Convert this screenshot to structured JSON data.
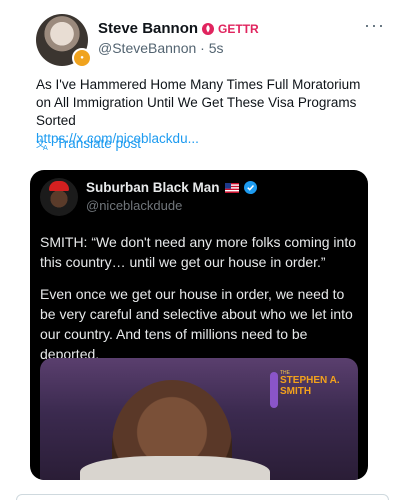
{
  "post": {
    "author_name": "Steve Bannon",
    "platform_label": "GETTR",
    "handle": "@SteveBannon",
    "separator": "·",
    "time": "5s",
    "more_label": "···",
    "text": "As I've Hammered Home Many Times Full Moratorium on All Immigration Until We Get These Visa Programs Sorted",
    "link": "https://x.com/niceblackdu...",
    "translate_label": "Translate post"
  },
  "quoted": {
    "author_name": "Suburban Black Man",
    "handle": "@niceblackdude",
    "paragraph_1": "SMITH: “We don't need any more folks coming into this country… until we get our house in order.”",
    "paragraph_2": "Even once we get our house in order, we need to be very careful and selective about who we let into our country. And tens of millions need to be deported.",
    "video_logo_small": "THE",
    "video_logo_title_1": "STEPHEN A.",
    "video_logo_title_2": "SMITH"
  },
  "colors": {
    "link": "#1d9bf0",
    "gettr": "#e0245e",
    "verified": "#1d9bf0",
    "embed_bg": "#000000",
    "logo_orange": "#f3a21c"
  },
  "icons": {
    "gettr": "gettr-flame-icon",
    "translate": "translate-icon",
    "verified": "verified-badge-icon",
    "flag": "us-flag-icon",
    "more": "more-options-icon"
  }
}
